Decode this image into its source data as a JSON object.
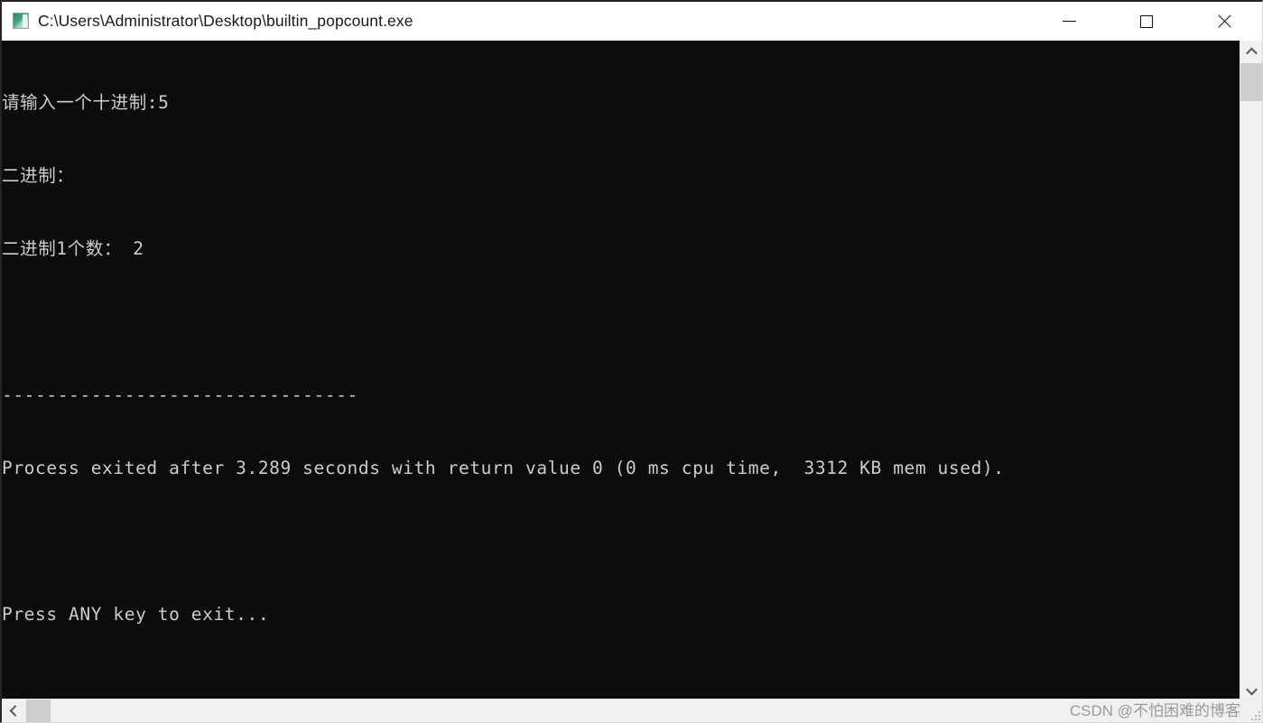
{
  "window": {
    "title": "C:\\Users\\Administrator\\Desktop\\builtin_popcount.exe",
    "icon": "console-app-icon",
    "controls": {
      "minimize_label": "—",
      "maximize_label": "□",
      "close_label": "✕"
    },
    "background_color": "#0c0c0c",
    "titlebar_color": "#ffffff",
    "text_color": "#cccccc"
  },
  "console": {
    "lines": [
      "请输入一个十进制:5",
      "二进制：",
      "二进制1个数： 2",
      "",
      "--------------------------------",
      "Process exited after 3.289 seconds with return value 0 (0 ms cpu time,  3312 KB mem used).",
      "",
      "Press ANY key to exit..."
    ],
    "prompt_text": "请输入一个十进制:",
    "input_value": "5",
    "binary_label": "二进制：",
    "binary_ones_label": "二进制1个数：",
    "binary_ones_count": "2",
    "separator": "--------------------------------",
    "exit_message": "Process exited after 3.289 seconds with return value 0 (0 ms cpu time,  3312 KB mem used).",
    "exit_seconds": "3.289",
    "return_value": "0",
    "cpu_time_ms": "0",
    "mem_used_kb": "3312",
    "press_key_message": "Press ANY key to exit..."
  },
  "scrollbars": {
    "vertical": {
      "up_arrow": "chevron-up-icon",
      "down_arrow": "chevron-down-icon",
      "thumb": "scroll-thumb"
    },
    "horizontal": {
      "left_arrow": "chevron-left-icon",
      "thumb": "scroll-thumb"
    }
  },
  "watermark": {
    "text": "CSDN @不怕困难的博客"
  }
}
